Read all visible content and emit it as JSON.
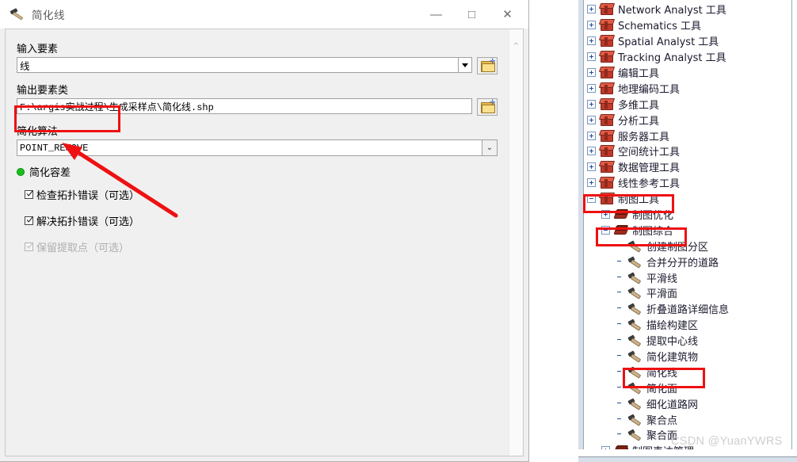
{
  "dialog": {
    "title": "简化线",
    "title_icon": "hammer-icon",
    "window_controls": {
      "minimize": "—",
      "maximize": "□",
      "close": "✕"
    },
    "fields": {
      "input_features": {
        "label": "输入要素",
        "value": "线",
        "dropdown_icon": "chevron-down-icon",
        "browse_icon": "folder-add-icon"
      },
      "output_feature_class": {
        "label": "输出要素类",
        "value": "F:\\argis实战过程\\生成采样点\\简化线.shp",
        "browse_icon": "folder-add-icon"
      },
      "simplification_algorithm": {
        "label": "简化算法",
        "value": "POINT_REMOVE",
        "dropdown_icon": "chevron-down-icon"
      },
      "simplification_tolerance": {
        "label": "简化容差",
        "status_icon": "green-dot-required-icon"
      }
    },
    "checkboxes": [
      {
        "label": "检查拓扑错误（可选）",
        "checked": true,
        "disabled": false
      },
      {
        "label": "解决拓扑错误（可选）",
        "checked": true,
        "disabled": false
      },
      {
        "label": "保留提取点（可选）",
        "checked": true,
        "disabled": true
      }
    ],
    "scrollbar": {
      "up_icon": "chevron-up-icon"
    }
  },
  "annotations": {
    "highlight_color": "#ee1111",
    "boxes": [
      {
        "name": "simplification-algorithm-highlight"
      },
      {
        "name": "cartography-tools-highlight"
      },
      {
        "name": "generalization-toolset-highlight"
      },
      {
        "name": "simplify-line-tool-highlight"
      }
    ],
    "arrow": {
      "name": "pointer-arrow",
      "points_to": "简化容差"
    }
  },
  "tree": {
    "items": [
      {
        "label": "Network Analyst 工具",
        "icon": "toolbox-icon",
        "expander": "plus",
        "indent": 0
      },
      {
        "label": "Schematics 工具",
        "icon": "toolbox-icon",
        "expander": "plus",
        "indent": 0
      },
      {
        "label": "Spatial Analyst 工具",
        "icon": "toolbox-icon",
        "expander": "plus",
        "indent": 0
      },
      {
        "label": "Tracking Analyst 工具",
        "icon": "toolbox-icon",
        "expander": "plus",
        "indent": 0
      },
      {
        "label": "编辑工具",
        "icon": "toolbox-icon",
        "expander": "plus",
        "indent": 0
      },
      {
        "label": "地理编码工具",
        "icon": "toolbox-icon",
        "expander": "plus",
        "indent": 0
      },
      {
        "label": "多维工具",
        "icon": "toolbox-icon",
        "expander": "plus",
        "indent": 0
      },
      {
        "label": "分析工具",
        "icon": "toolbox-icon",
        "expander": "plus",
        "indent": 0
      },
      {
        "label": "服务器工具",
        "icon": "toolbox-icon",
        "expander": "plus",
        "indent": 0
      },
      {
        "label": "空间统计工具",
        "icon": "toolbox-icon",
        "expander": "plus",
        "indent": 0
      },
      {
        "label": "数据管理工具",
        "icon": "toolbox-icon",
        "expander": "plus",
        "indent": 0
      },
      {
        "label": "线性参考工具",
        "icon": "toolbox-icon",
        "expander": "plus",
        "indent": 0
      },
      {
        "label": "制图工具",
        "icon": "toolbox-icon",
        "expander": "minus",
        "indent": 0
      },
      {
        "label": "制图优化",
        "icon": "toolset-icon",
        "expander": "plus",
        "indent": 1
      },
      {
        "label": "制图综合",
        "icon": "toolset-icon",
        "expander": "minus",
        "indent": 1
      },
      {
        "label": "创建制图分区",
        "icon": "hammer-icon",
        "expander": "none",
        "indent": 2
      },
      {
        "label": "合并分开的道路",
        "icon": "hammer-icon",
        "expander": "none",
        "indent": 2
      },
      {
        "label": "平滑线",
        "icon": "hammer-icon",
        "expander": "none",
        "indent": 2
      },
      {
        "label": "平滑面",
        "icon": "hammer-icon",
        "expander": "none",
        "indent": 2
      },
      {
        "label": "折叠道路详细信息",
        "icon": "hammer-icon",
        "expander": "none",
        "indent": 2
      },
      {
        "label": "描绘构建区",
        "icon": "hammer-icon",
        "expander": "none",
        "indent": 2
      },
      {
        "label": "提取中心线",
        "icon": "hammer-icon",
        "expander": "none",
        "indent": 2
      },
      {
        "label": "简化建筑物",
        "icon": "hammer-icon",
        "expander": "none",
        "indent": 2
      },
      {
        "label": "简化线",
        "icon": "hammer-icon",
        "expander": "none",
        "indent": 2
      },
      {
        "label": "简化面",
        "icon": "hammer-icon",
        "expander": "none",
        "indent": 2
      },
      {
        "label": "细化道路网",
        "icon": "hammer-icon",
        "expander": "none",
        "indent": 2
      },
      {
        "label": "聚合点",
        "icon": "hammer-icon",
        "expander": "none",
        "indent": 2
      },
      {
        "label": "聚合面",
        "icon": "hammer-icon",
        "expander": "none",
        "indent": 2
      },
      {
        "label": "制图表达管理",
        "icon": "toolset-icon",
        "expander": "plus",
        "indent": 1
      }
    ]
  },
  "watermark": "CSDN @YuanYWRS"
}
